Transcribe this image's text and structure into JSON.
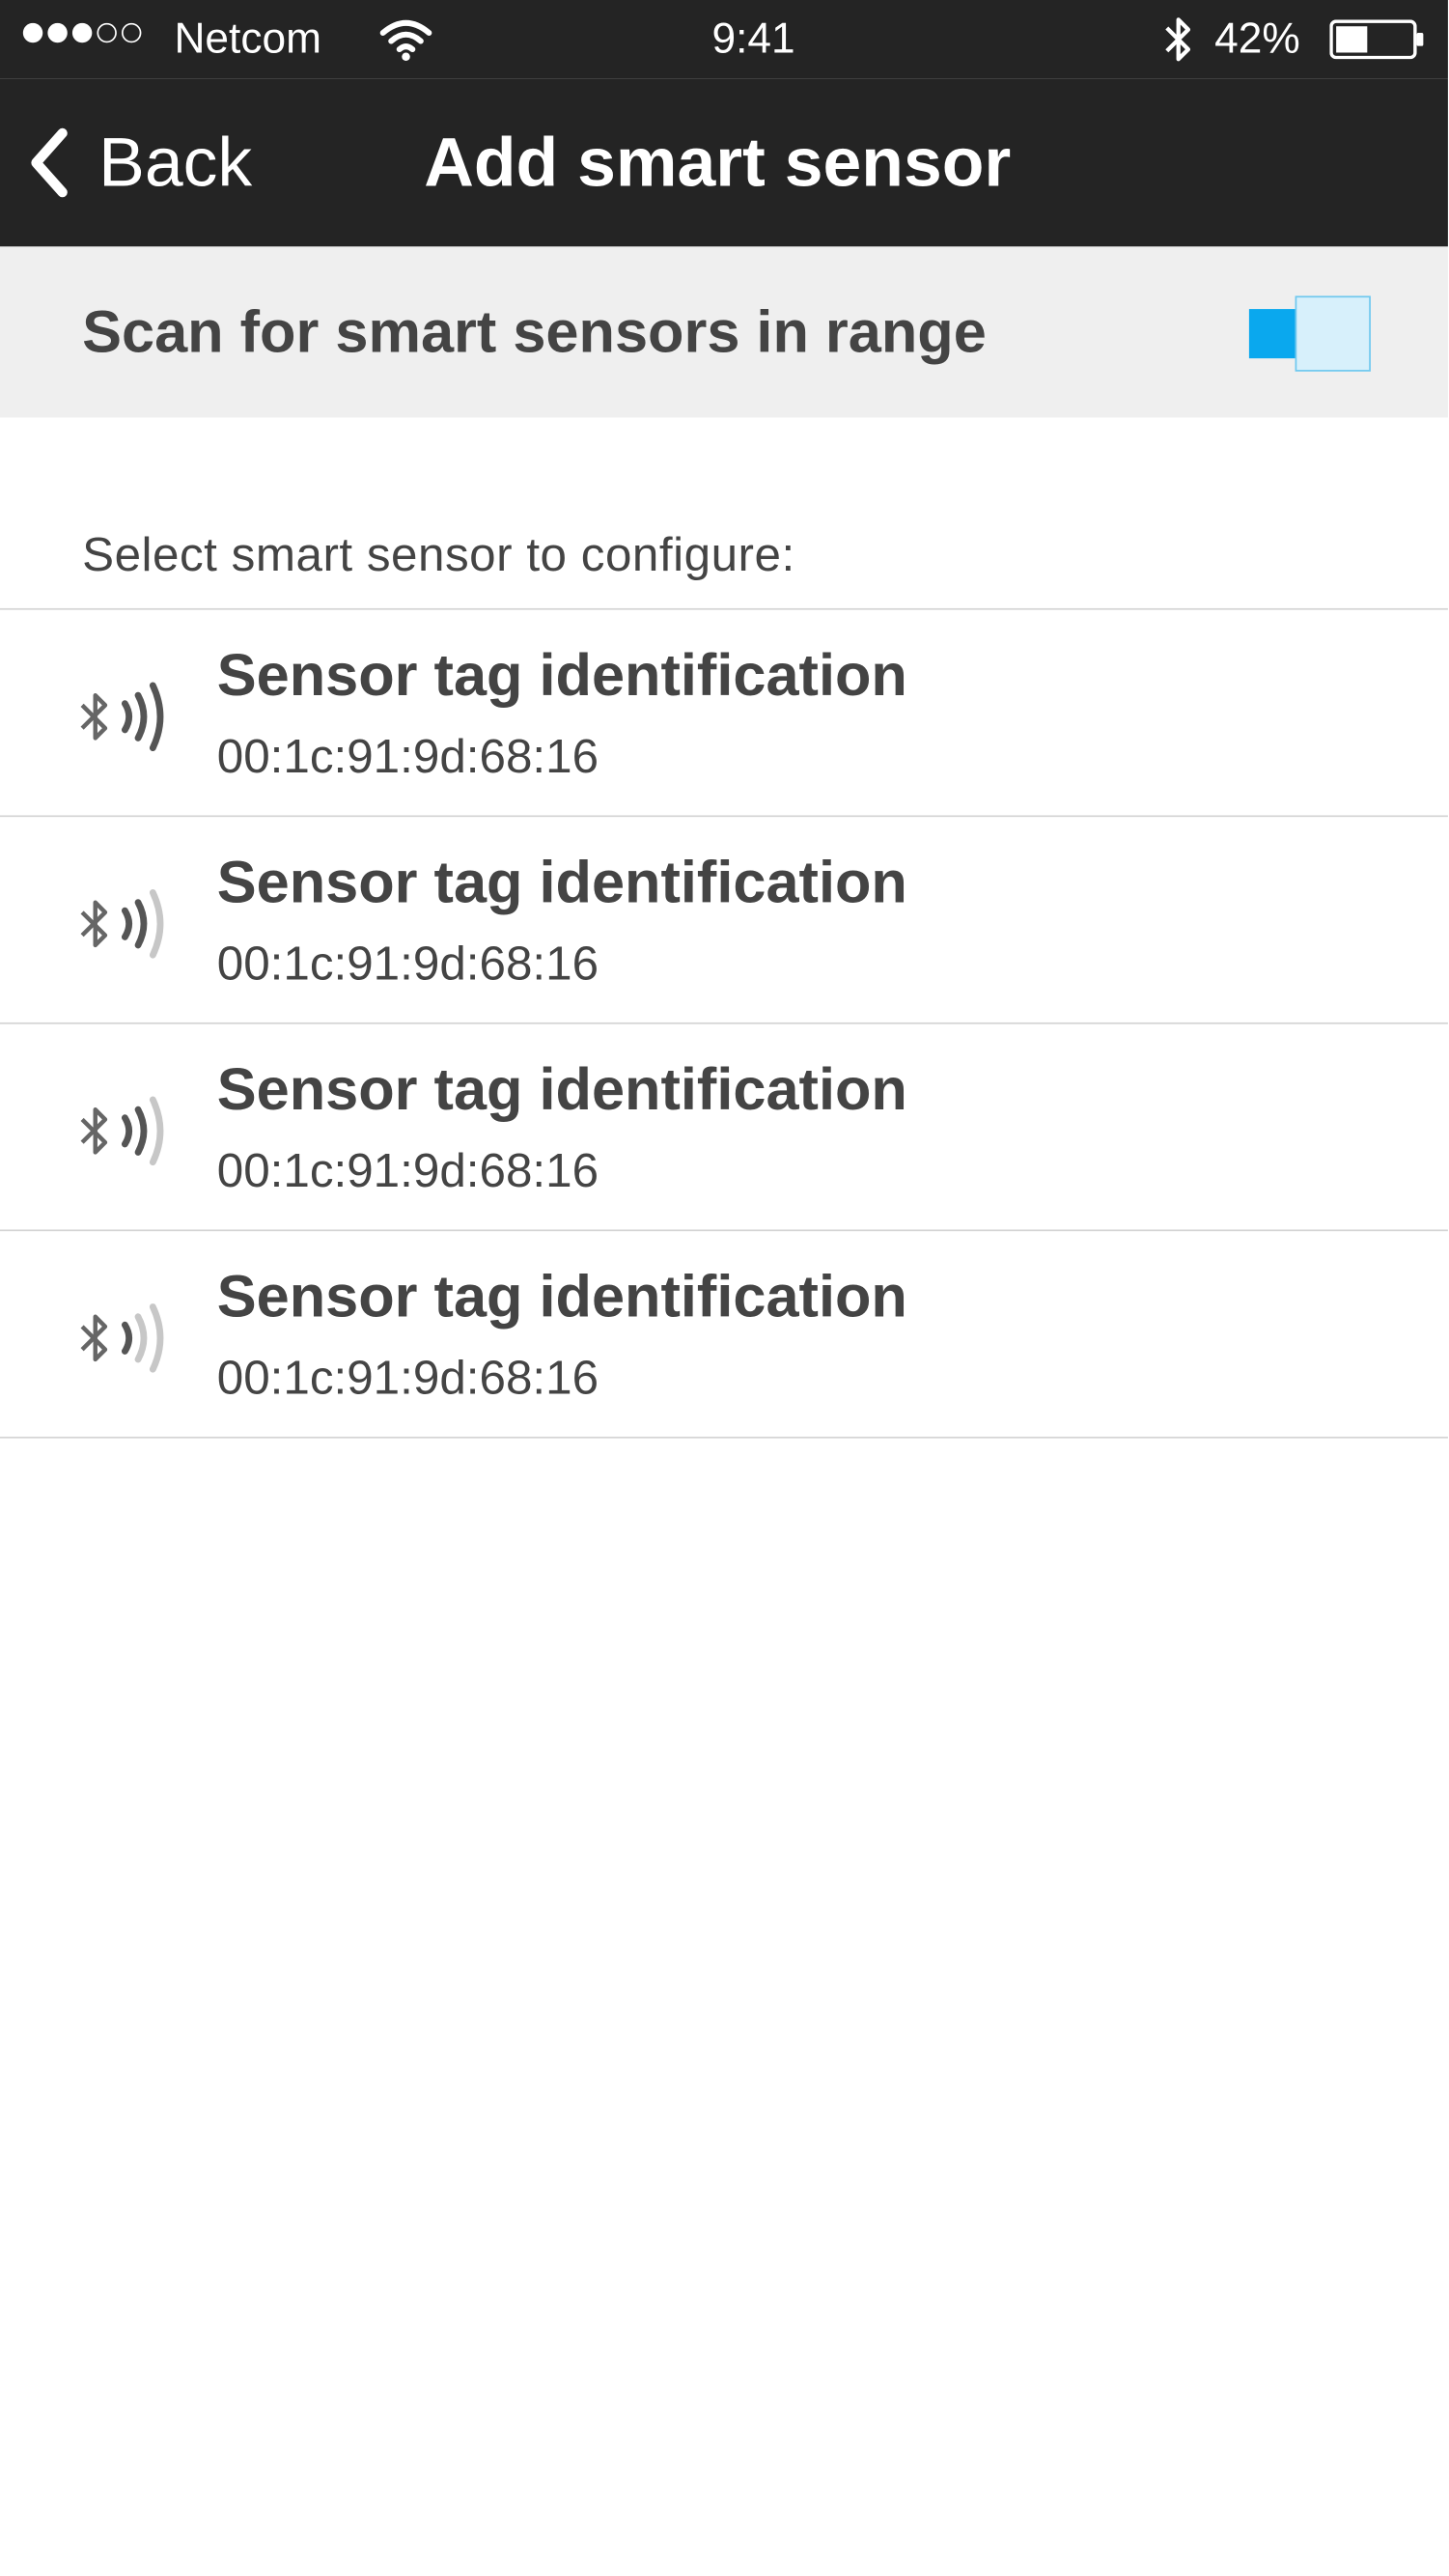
{
  "status_bar": {
    "carrier": "Netcom",
    "time": "9:41",
    "battery_percent": "42%",
    "battery_level": 0.42,
    "signal_bars_filled": 3,
    "signal_bars_total": 5
  },
  "nav": {
    "back_label": "Back",
    "title": "Add smart sensor"
  },
  "scan": {
    "label": "Scan for smart sensors in range",
    "enabled": true,
    "accent_color": "#0aa8ee"
  },
  "list": {
    "header": "Select smart sensor to configure:",
    "items": [
      {
        "name": "Sensor tag identification",
        "address": "00:1c:91:9d:68:16",
        "signal_strength": 3,
        "icon": "bluetooth-signal-icon"
      },
      {
        "name": "Sensor tag identification",
        "address": "00:1c:91:9d:68:16",
        "signal_strength": 2,
        "icon": "bluetooth-signal-icon"
      },
      {
        "name": "Sensor tag identification",
        "address": "00:1c:91:9d:68:16",
        "signal_strength": 2,
        "icon": "bluetooth-signal-icon"
      },
      {
        "name": "Sensor tag identification",
        "address": "00:1c:91:9d:68:16",
        "signal_strength": 1,
        "icon": "bluetooth-signal-icon"
      }
    ]
  },
  "colors": {
    "bar_background": "#242424",
    "row_background": "#efefef",
    "text": "#444444",
    "divider": "#d4d4d4"
  }
}
